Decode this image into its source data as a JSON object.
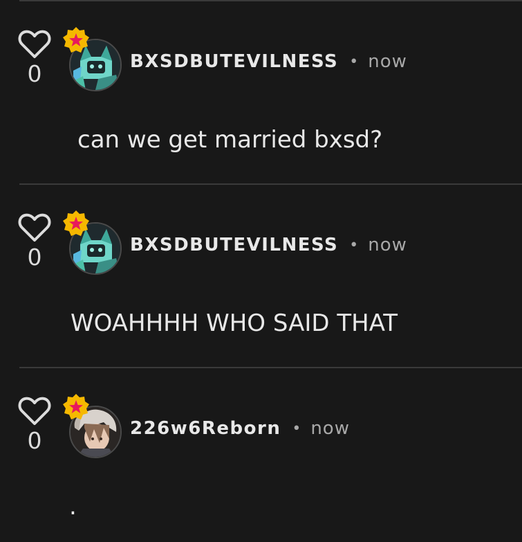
{
  "colors": {
    "background": "#181818",
    "divider": "#3a3a3a",
    "badge": "#f5b800",
    "badge_star": "#e8195c",
    "text": "#e8e8e8",
    "muted": "#a8a8a8"
  },
  "comments": [
    {
      "username": "BXSDBUTEVILNESS",
      "separator": "•",
      "time": "now",
      "likes": "0",
      "text": "can we get married bxsd?",
      "avatar": "cat-avatar",
      "badge": "star-badge-icon"
    },
    {
      "username": "BXSDBUTEVILNESS",
      "separator": "•",
      "time": "now",
      "likes": "0",
      "text": "WOAHHHH WHO SAID THAT",
      "avatar": "cat-avatar",
      "badge": "star-badge-icon"
    },
    {
      "username": "226w6Reborn",
      "separator": "•",
      "time": "now",
      "likes": "0",
      "text": ".",
      "avatar": "anime-character-avatar",
      "badge": "star-badge-icon"
    }
  ]
}
